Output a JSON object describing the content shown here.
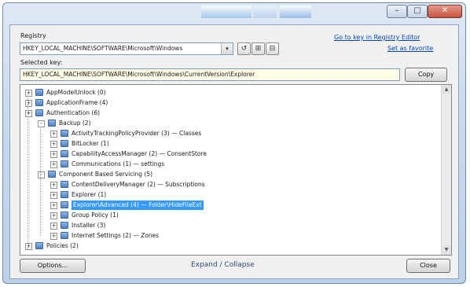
{
  "window": {
    "controls": {
      "minimize": "–",
      "maximize": "□",
      "close": "✕"
    }
  },
  "top": {
    "label": "Registry",
    "combo_value": "HKEY_LOCAL_MACHINE\\SOFTWARE\\Microsoft\\Windows",
    "combo_arrow": "▾",
    "icon_buttons": [
      "↺",
      "⊞",
      "⊟"
    ],
    "links": [
      "Go to key in Registry Editor",
      "Set as favorite"
    ]
  },
  "path": {
    "label": "Selected key:",
    "value": "HKEY_LOCAL_MACHINE\\SOFTWARE\\Microsoft\\Windows\\CurrentVersion\\Explorer",
    "copy_label": "Copy"
  },
  "tree": {
    "rows": [
      {
        "text": "AppModelUnlock (0)",
        "indent": 0,
        "exp": "+"
      },
      {
        "text": "ApplicationFrame (4)",
        "indent": 0,
        "exp": "+"
      },
      {
        "text": "Authentication (6)",
        "indent": 0,
        "exp": "+"
      },
      {
        "text": "Backup (2)",
        "indent": 1,
        "exp": "-"
      },
      {
        "text": "ActivityTrackingPolicyProvider (3) — Classes",
        "indent": 2,
        "exp": "+"
      },
      {
        "text": "BitLocker (1)",
        "indent": 2,
        "exp": "+"
      },
      {
        "text": "CapabilityAccessManager (2) — ConsentStore",
        "indent": 2,
        "exp": "+"
      },
      {
        "text": "Communications (1) — settings",
        "indent": 2,
        "exp": "+"
      },
      {
        "text": "Component Based Servicing (5)",
        "indent": 1,
        "exp": "-"
      },
      {
        "text": "ContentDeliveryManager (2) — Subscriptions",
        "indent": 2,
        "exp": "+"
      },
      {
        "text": "Explorer (1)",
        "indent": 2,
        "exp": "+"
      },
      {
        "text": "Explorer\\Advanced (4) — Folder\\HideFileExt",
        "indent": 2,
        "exp": "+",
        "selected": true
      },
      {
        "text": "Group Policy (1)",
        "indent": 2,
        "exp": "+"
      },
      {
        "text": "Installer (3)",
        "indent": 2,
        "exp": "+"
      },
      {
        "text": "Internet Settings (2) — Zones",
        "indent": 2,
        "exp": "+"
      },
      {
        "text": "Policies (2)",
        "indent": 0,
        "exp": "+"
      }
    ]
  },
  "footer": {
    "left_button": "Options...",
    "center_text": "Expand / Collapse",
    "right_button": "Close"
  }
}
